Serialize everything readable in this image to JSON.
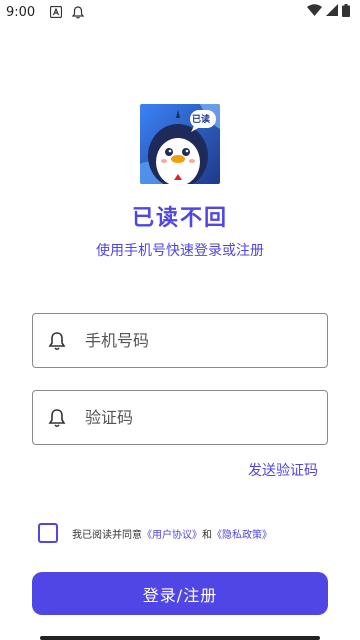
{
  "status_bar": {
    "time": "9:00",
    "left_icons": [
      "a-icon",
      "notification-bell-icon"
    ],
    "right_icons": [
      "wifi-icon",
      "signal-icon",
      "battery-icon"
    ]
  },
  "app": {
    "title": "已读不回",
    "subtitle": "使用手机号快速登录或注册",
    "logo_badge": "已读",
    "accent_color": "#4f46e5"
  },
  "form": {
    "phone_placeholder": "手机号码",
    "code_placeholder": "验证码",
    "send_code_label": "发送验证码"
  },
  "agreement": {
    "prefix": "我已阅读并同意",
    "user_agreement": "《用户协议》",
    "and": "和",
    "privacy_policy": "《隐私政策》"
  },
  "actions": {
    "login_label": "登录/注册"
  }
}
